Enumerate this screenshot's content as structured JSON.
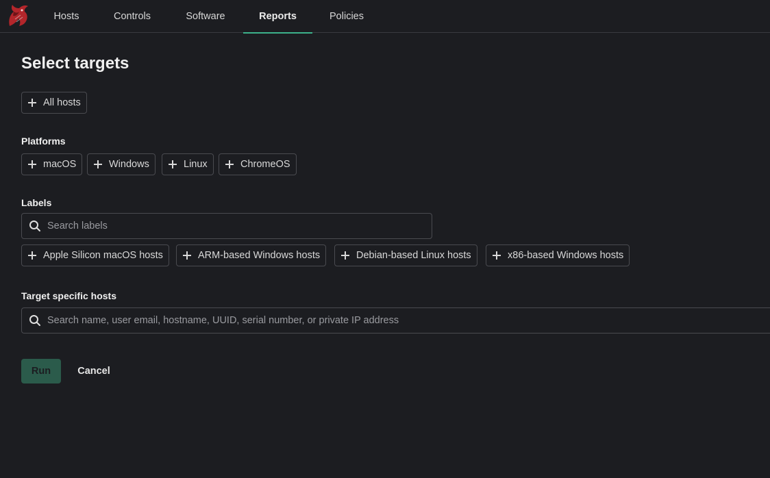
{
  "nav": {
    "tabs": [
      {
        "label": "Hosts"
      },
      {
        "label": "Controls"
      },
      {
        "label": "Software"
      },
      {
        "label": "Reports",
        "active": true
      },
      {
        "label": "Policies"
      }
    ]
  },
  "page": {
    "title": "Select targets",
    "all_hosts": "All hosts"
  },
  "platforms": {
    "label": "Platforms",
    "items": [
      "macOS",
      "Windows",
      "Linux",
      "ChromeOS"
    ]
  },
  "labels": {
    "label": "Labels",
    "search_placeholder": "Search labels",
    "items": [
      "Apple Silicon macOS hosts",
      "ARM-based Windows hosts",
      "Debian-based Linux hosts",
      "x86-based Windows hosts"
    ]
  },
  "specific_hosts": {
    "label": "Target specific hosts",
    "search_placeholder": "Search name, user email, hostname, UUID, serial number, or private IP address"
  },
  "actions": {
    "run": "Run",
    "cancel": "Cancel"
  },
  "colors": {
    "background": "#1c1d21",
    "accent": "#3db28c",
    "run_button": "#2b5b4b",
    "border": "#4a4b50"
  },
  "icons": {
    "logo": "dragon-logo-icon",
    "chip": "plus-icon",
    "search": "search-icon"
  }
}
